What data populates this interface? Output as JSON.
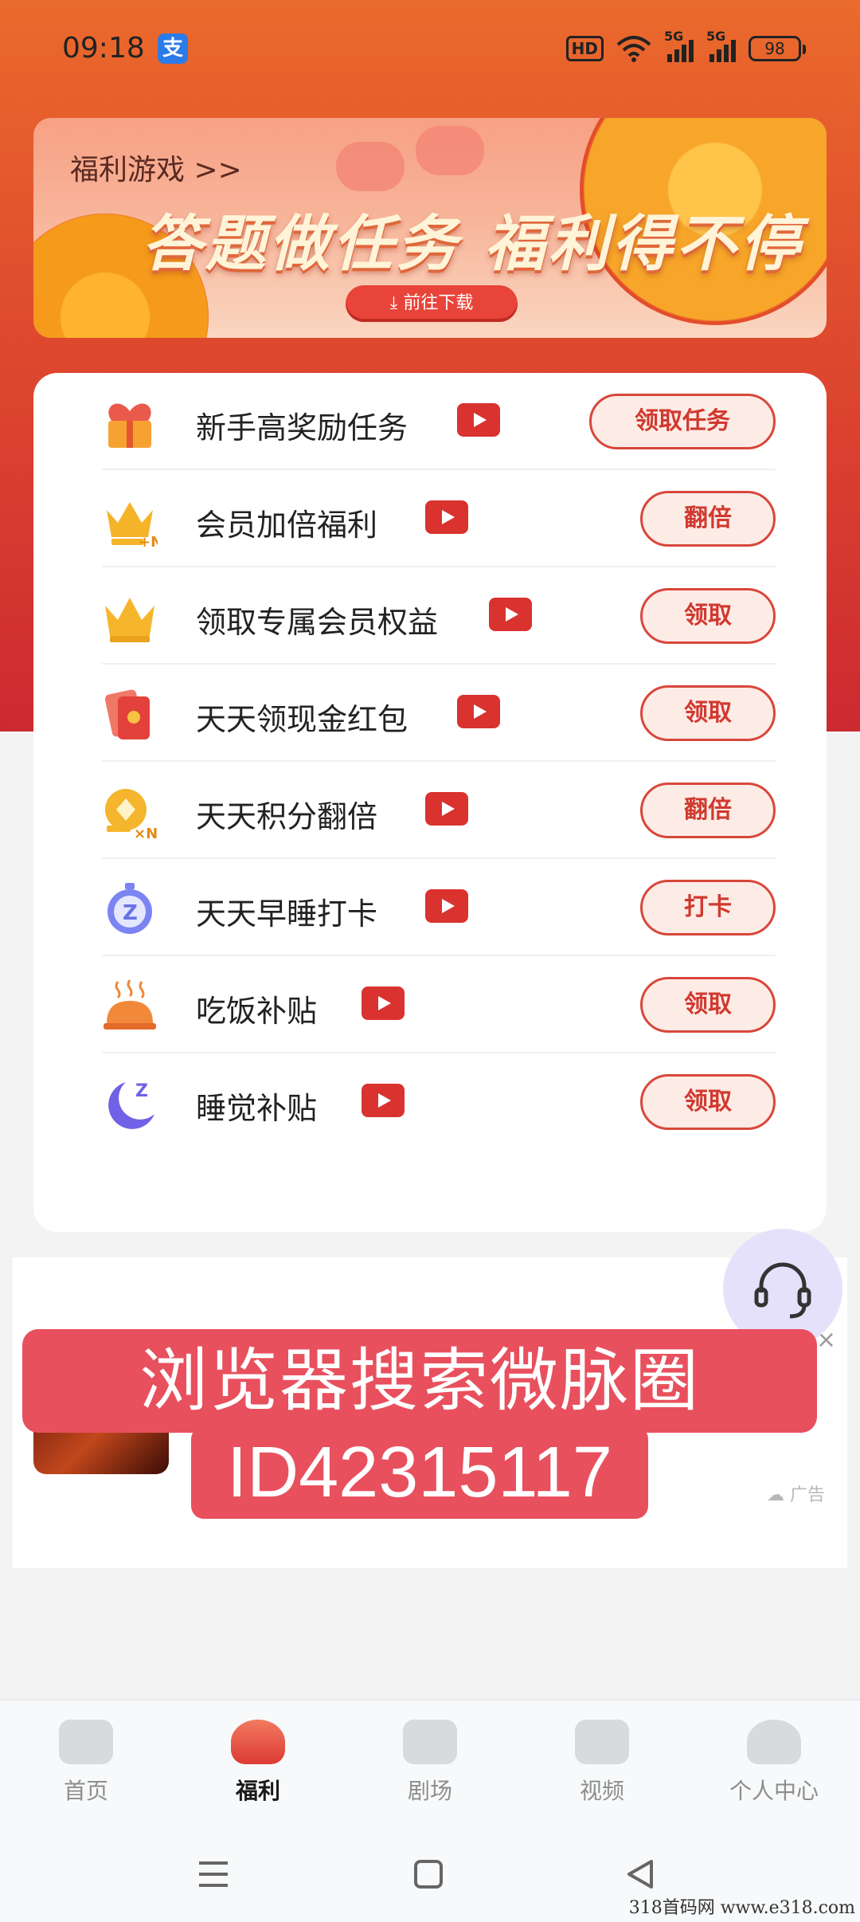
{
  "status_bar": {
    "time": "09:18",
    "app_icon": "支",
    "hd_label": "HD",
    "net1": "5G",
    "net2": "5G",
    "battery": "98"
  },
  "banner": {
    "link_text": "福利游戏 >>",
    "headline": "答题做任务 福利得不停",
    "button_label": "前往下载"
  },
  "tasks": [
    {
      "name": "新手高奖励任务",
      "button": "领取任务",
      "icon": "gift-heart-icon"
    },
    {
      "name": "会员加倍福利",
      "button": "翻倍",
      "icon": "crown-multiplier-icon"
    },
    {
      "name": "领取专属会员权益",
      "button": "领取",
      "icon": "crown-icon"
    },
    {
      "name": "天天领现金红包",
      "button": "领取",
      "icon": "red-envelope-icon"
    },
    {
      "name": "天天积分翻倍",
      "button": "翻倍",
      "icon": "points-multiplier-icon"
    },
    {
      "name": "天天早睡打卡",
      "button": "打卡",
      "icon": "alarm-clock-icon"
    },
    {
      "name": "吃饭补贴",
      "button": "领取",
      "icon": "food-cloche-icon"
    },
    {
      "name": "睡觉补贴",
      "button": "领取",
      "icon": "moon-sleep-icon"
    }
  ],
  "ad": {
    "label": "广告",
    "close": "×"
  },
  "overlay": {
    "line1": "浏览器搜索微脉圈",
    "line2": "ID42315117"
  },
  "tab_bar": [
    {
      "label": "首页",
      "active": false
    },
    {
      "label": "福利",
      "active": true
    },
    {
      "label": "剧场",
      "active": false
    },
    {
      "label": "视频",
      "active": false
    },
    {
      "label": "个人中心",
      "active": false
    }
  ],
  "watermark": "318首码网  www.e318.com",
  "colors": {
    "accent": "#d0392f",
    "header_gradient_top": "#ea6a2c",
    "header_gradient_bottom": "#cc2a31",
    "button_bg": "#fdebe6"
  }
}
